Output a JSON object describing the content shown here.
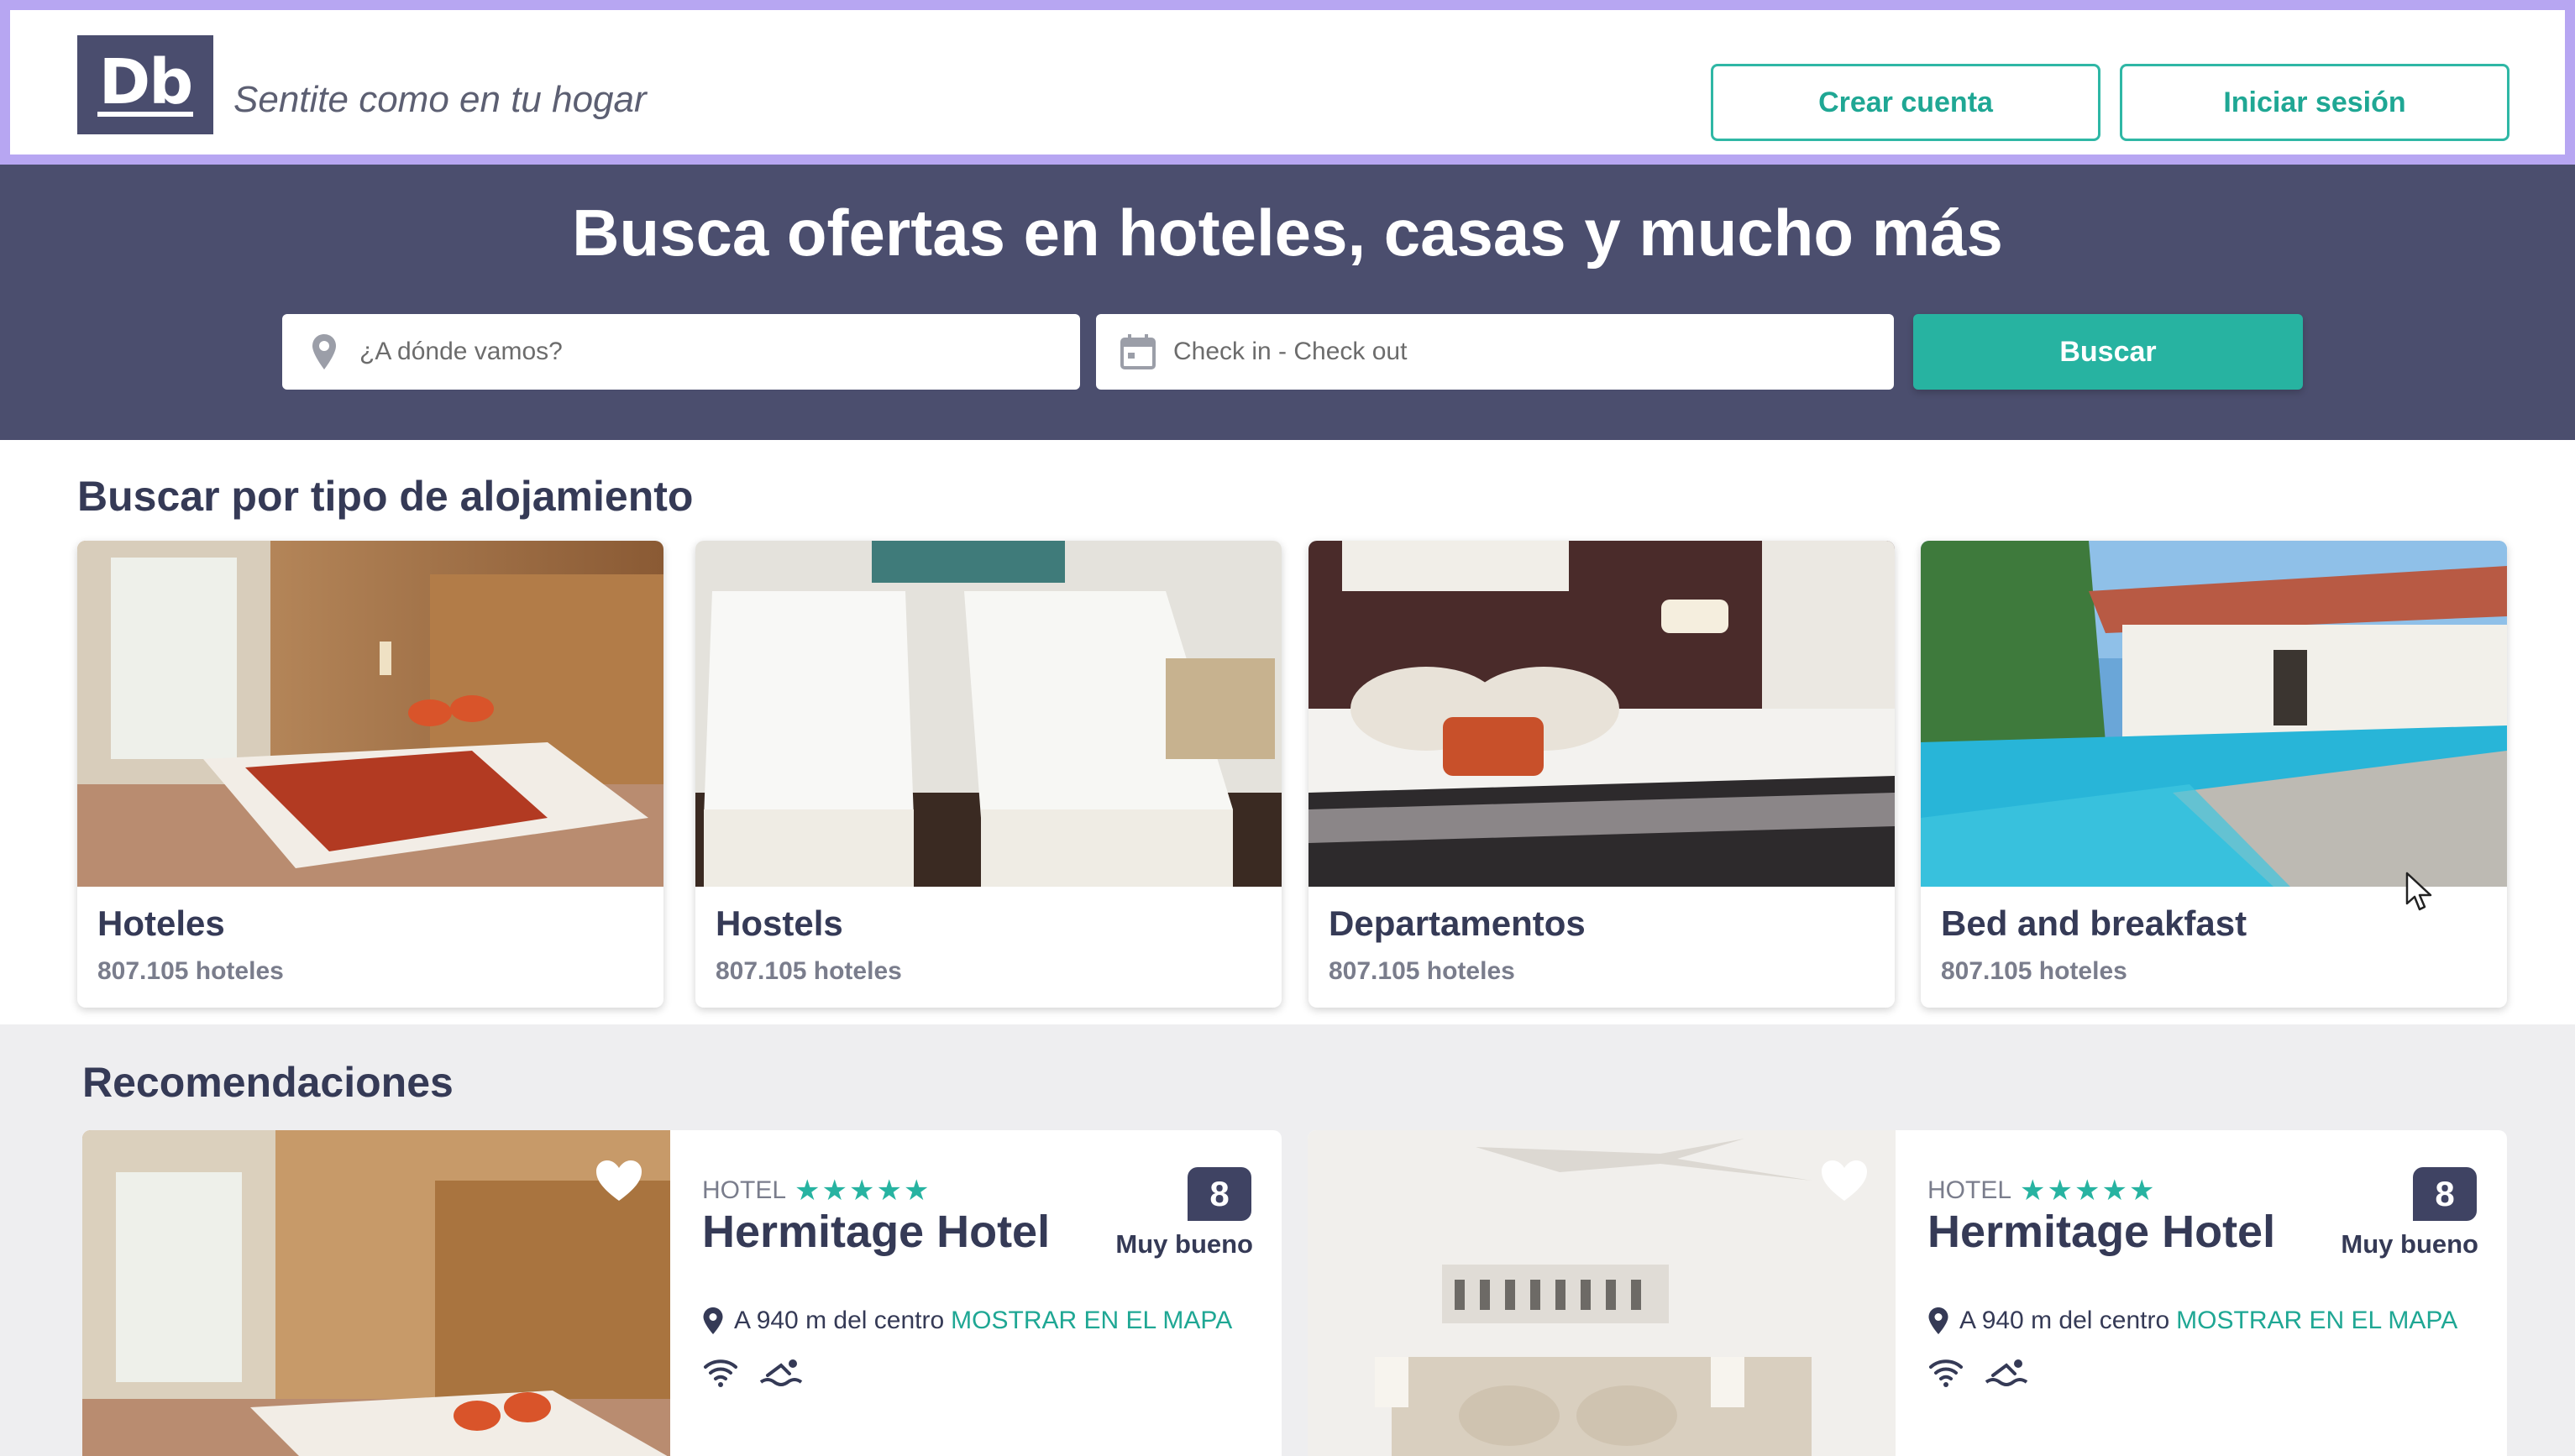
{
  "header": {
    "logo_text": "Db",
    "tagline": "Sentite como en tu hogar",
    "create_account": "Crear cuenta",
    "login": "Iniciar sesión"
  },
  "hero": {
    "title": "Busca ofertas en hoteles, casas y mucho más",
    "where_placeholder": "¿A dónde vamos?",
    "dates_placeholder": "Check in - Check out",
    "search_button": "Buscar"
  },
  "types": {
    "title": "Buscar por tipo de alojamiento",
    "items": [
      {
        "name": "Hoteles",
        "count": "807.105 hoteles"
      },
      {
        "name": "Hostels",
        "count": "807.105 hoteles"
      },
      {
        "name": "Departamentos",
        "count": "807.105 hoteles"
      },
      {
        "name": "Bed and breakfast",
        "count": "807.105 hoteles"
      }
    ]
  },
  "recommendations": {
    "title": "Recomendaciones",
    "items": [
      {
        "type": "HOTEL",
        "stars": "★★★★★",
        "name": "Hermitage Hotel",
        "score": "8",
        "score_label": "Muy bueno",
        "location": "A 940 m del centro",
        "map_link": "MOSTRAR EN EL MAPA"
      },
      {
        "type": "HOTEL",
        "stars": "★★★★★",
        "name": "Hermitage Hotel",
        "score": "8",
        "score_label": "Muy bueno",
        "location": "A 940 m del centro",
        "map_link": "MOSTRAR EN EL MAPA"
      }
    ]
  },
  "colors": {
    "primary_dark": "#4b4e6e",
    "accent_teal": "#27b3a1",
    "highlight_border": "#b7a6f2"
  }
}
